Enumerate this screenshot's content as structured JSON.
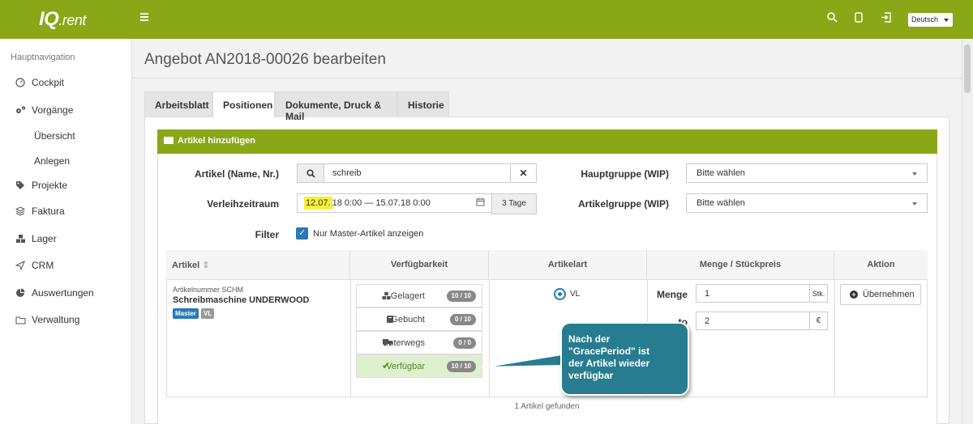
{
  "topbar": {
    "logo_main": "IQ",
    "logo_suffix": ".rent",
    "language": "Deutsch"
  },
  "sidebar": {
    "header": "Hauptnavigation",
    "items": [
      {
        "label": "Cockpit",
        "icon": "gauge-icon"
      },
      {
        "label": "Vorgänge",
        "icon": "gears-icon"
      },
      {
        "label": "Übersicht"
      },
      {
        "label": "Anlegen"
      },
      {
        "label": "Projekte",
        "icon": "tag-icon"
      },
      {
        "label": "Faktura",
        "icon": "layers-icon"
      },
      {
        "label": "Lager",
        "icon": "boxes-icon"
      },
      {
        "label": "CRM",
        "icon": "send-icon"
      },
      {
        "label": "Auswertungen",
        "icon": "pie-chart-icon"
      },
      {
        "label": "Verwaltung",
        "icon": "folder-icon"
      }
    ]
  },
  "page": {
    "title": "Angebot AN2018-00026 bearbeiten"
  },
  "tabs": [
    "Arbeitsblatt",
    "Positionen",
    "Dokumente, Druck & Mail",
    "Historie"
  ],
  "active_tab": "Positionen",
  "box": {
    "title": "Artikel hinzufügen"
  },
  "form": {
    "artikel_label": "Artikel (Name, Nr.)",
    "artikel_value": "schreib",
    "zeitraum_label": "Verleihzeitraum",
    "zeitraum_highlight": "12.07.",
    "zeitraum_rest": "18 0:00 — 15.07.18 0:00",
    "zeitraum_days": "3 Tage",
    "filter_label": "Filter",
    "filter_checkbox": "Nur Master-Artikel anzeigen",
    "hauptgruppe_label": "Hauptgruppe (WIP)",
    "hauptgruppe_value": "Bitte wählen",
    "artikelgruppe_label": "Artikelgruppe (WIP)",
    "artikelgruppe_value": "Bitte wählen"
  },
  "table": {
    "headers": [
      "Artikel",
      "Verfügbarkeit",
      "Artikelart",
      "Menge / Stückpreis",
      "Aktion"
    ],
    "row": {
      "artnr": "Artikelnummer SCHM",
      "name": "Schreibmaschine UNDERWOOD",
      "badges": [
        "Master",
        "VL"
      ],
      "availability": [
        {
          "label": "Gelagert",
          "count": "10 / 10"
        },
        {
          "label": "Gebucht",
          "count": "0 / 10"
        },
        {
          "label": "Unterwegs",
          "count": "0 / 0"
        },
        {
          "label": "Verfügbar",
          "count": "10 / 10"
        }
      ],
      "artikelart": "VL",
      "menge_label": "Menge",
      "menge_value": "1",
      "menge_unit": "Stk.",
      "preis_label_visible": "to",
      "preis_value": "2",
      "preis_unit": "€",
      "action": "Übernehmen"
    },
    "footer": "1 Artikel gefunden"
  },
  "callout": {
    "lines": [
      "Nach der",
      "\"GracePeriod\" ist",
      "der Artikel wieder",
      "verfügbar"
    ]
  }
}
